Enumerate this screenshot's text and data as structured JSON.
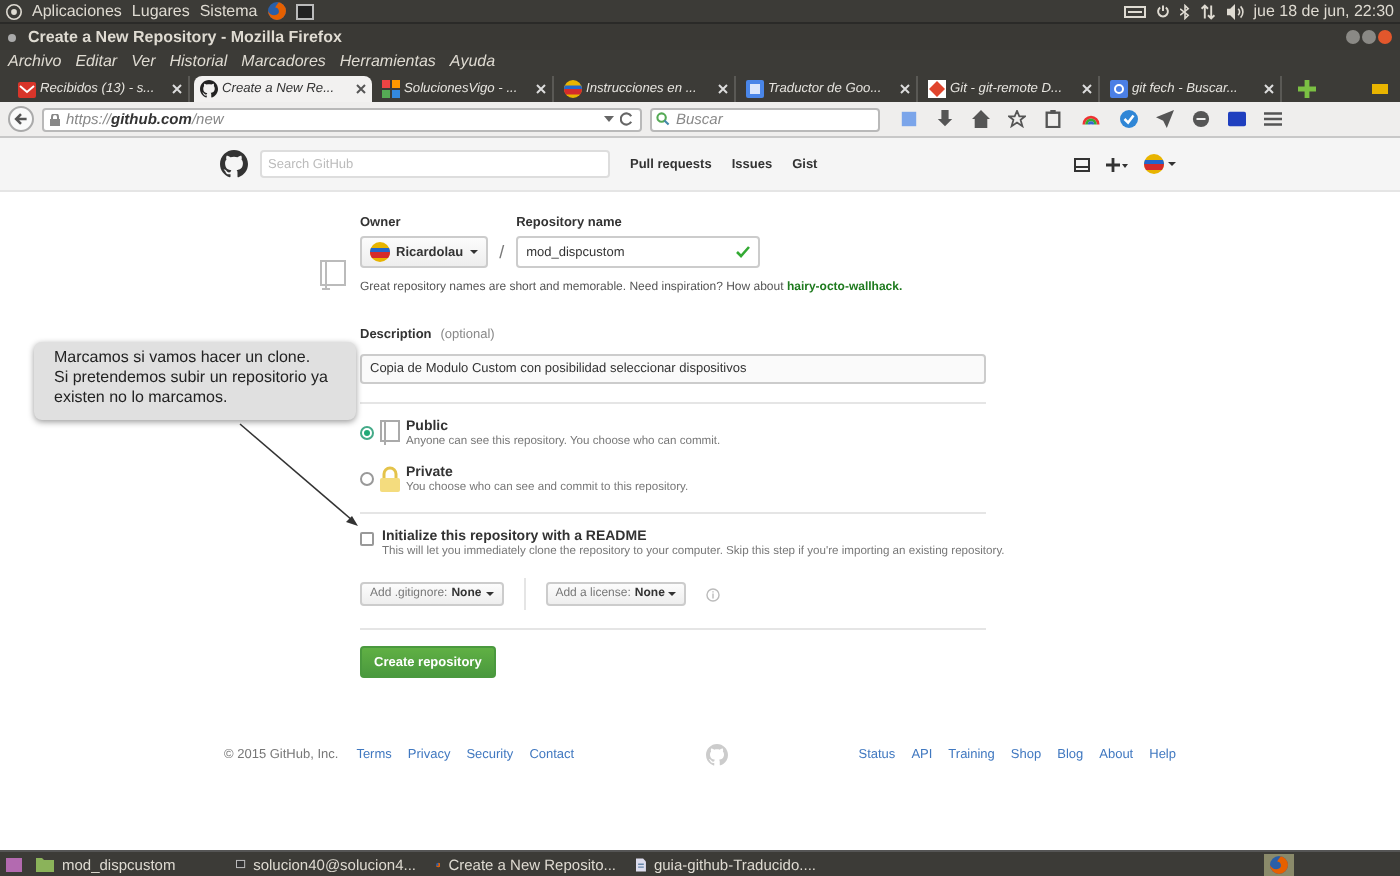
{
  "top_panel": {
    "menus": [
      "Aplicaciones",
      "Lugares",
      "Sistema"
    ],
    "clock": "jue 18 de jun, 22:30"
  },
  "window": {
    "title": "Create a New Repository - Mozilla Firefox"
  },
  "menu_bar": [
    "Archivo",
    "Editar",
    "Ver",
    "Historial",
    "Marcadores",
    "Herramientas",
    "Ayuda"
  ],
  "tabs": [
    {
      "title": "Recibidos (13) - s...",
      "selected": false,
      "kind": "mail"
    },
    {
      "title": "Create a New Re...",
      "selected": true,
      "kind": "github"
    },
    {
      "title": "SolucionesVigo - ...",
      "selected": false,
      "kind": "puzzle"
    },
    {
      "title": "Instrucciones en ...",
      "selected": false,
      "kind": "ball"
    },
    {
      "title": "Traductor de Goo...",
      "selected": false,
      "kind": "translate"
    },
    {
      "title": "Git - git-remote D...",
      "selected": false,
      "kind": "git"
    },
    {
      "title": "git fech - Buscar...",
      "selected": false,
      "kind": "search"
    }
  ],
  "address_bar": {
    "url": "https://**github.com**/new"
  },
  "search_bar": {
    "placeholder": "Buscar"
  },
  "github_header": {
    "search_placeholder": "Search GitHub",
    "nav": [
      "Pull requests",
      "Issues",
      "Gist"
    ]
  },
  "form": {
    "owner_label": "Owner",
    "owner": "Ricardolau",
    "separator": "/",
    "repo_label": "Repository name",
    "repo_name": "mod_dispcustom",
    "name_valid": true,
    "hint": "Great repository names are short and memorable. Need inspiration? How about",
    "suggestion": "hairy-octo-wallhack.",
    "description_label": "Description",
    "description_optional": "(optional)",
    "description": "Copia de Modulo Custom con posibilidad seleccionar dispositivos",
    "visibility": [
      {
        "label": "Public",
        "detail": "Anyone can see this repository. You choose who can commit.",
        "selected": true,
        "kind": "book"
      },
      {
        "label": "Private",
        "detail": "You choose who can see and commit to this repository.",
        "selected": false,
        "kind": "lock"
      }
    ],
    "readme": {
      "label": "Initialize this repository with a README",
      "detail": "This will let you immediately clone the repository to your computer. Skip this step if you're importing an existing repository.",
      "checked": false
    },
    "gitignore": {
      "label": "Add .gitignore:",
      "value": "None"
    },
    "license": {
      "label": "Add a license:",
      "value": "None"
    },
    "submit": "Create repository"
  },
  "footer": {
    "copyright": "© 2015 GitHub, Inc.",
    "left_links": [
      "Terms",
      "Privacy",
      "Security",
      "Contact"
    ],
    "right_links": [
      "Status",
      "API",
      "Training",
      "Shop",
      "Blog",
      "About",
      "Help"
    ]
  },
  "callout": {
    "lines": [
      "Marcamos si vamos hacer un clone.",
      "Si pretendemos subir un repositorio ya",
      "existen no lo marcamos."
    ]
  },
  "taskbar": [
    {
      "label": "mod_dispcustom",
      "kind": "folder"
    },
    {
      "label": "solucion40@solucion4...",
      "kind": "terminal"
    },
    {
      "label": "Create a New Reposito...",
      "kind": "firefox"
    },
    {
      "label": "guia-github-Traducido....",
      "kind": "document"
    }
  ]
}
